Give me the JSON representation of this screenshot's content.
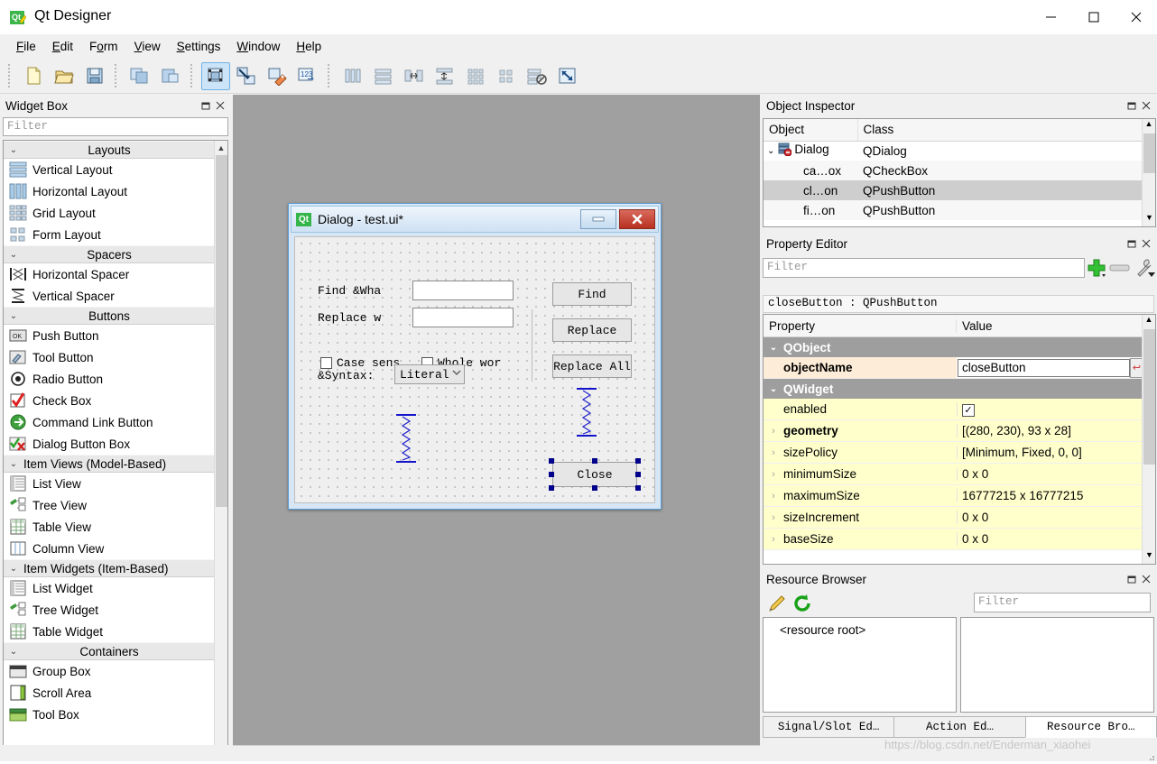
{
  "window": {
    "title": "Qt Designer",
    "app_icon": "qt-designer-icon",
    "minimize": "—",
    "maximize": "□",
    "close": "✕"
  },
  "menubar": [
    {
      "label": "File",
      "accel": "F"
    },
    {
      "label": "Edit",
      "accel": "E"
    },
    {
      "label": "Form",
      "accel": "o"
    },
    {
      "label": "View",
      "accel": "V"
    },
    {
      "label": "Settings",
      "accel": "S"
    },
    {
      "label": "Window",
      "accel": "W"
    },
    {
      "label": "Help",
      "accel": "H"
    }
  ],
  "toolbar": {
    "groups": [
      {
        "items": [
          {
            "name": "new-form-icon"
          },
          {
            "name": "open-form-icon"
          },
          {
            "name": "save-form-icon"
          }
        ]
      },
      {
        "items": [
          {
            "name": "undo-icon"
          },
          {
            "name": "redo-icon"
          }
        ]
      },
      {
        "items": [
          {
            "name": "edit-widgets-icon",
            "active": true
          },
          {
            "name": "edit-signals-slots-icon",
            "active": false
          },
          {
            "name": "edit-buddies-icon",
            "active": false
          },
          {
            "name": "edit-tab-order-icon",
            "active": false
          }
        ]
      },
      {
        "items": [
          {
            "name": "layout-horizontally-icon"
          },
          {
            "name": "layout-vertically-icon"
          },
          {
            "name": "layout-splitter-horizontal-icon"
          },
          {
            "name": "layout-splitter-vertical-icon"
          },
          {
            "name": "layout-grid-icon"
          },
          {
            "name": "layout-form-icon"
          },
          {
            "name": "break-layout-icon"
          },
          {
            "name": "adjust-size-icon"
          }
        ]
      }
    ]
  },
  "widget_box": {
    "title": "Widget Box",
    "float_icon": "float-icon",
    "close_icon": "close-icon",
    "filter_placeholder": "Filter",
    "categories": [
      {
        "name": "Layouts",
        "centered": true,
        "items": [
          {
            "label": "Vertical Layout",
            "icon": "vertical-layout-icon"
          },
          {
            "label": "Horizontal Layout",
            "icon": "horizontal-layout-icon"
          },
          {
            "label": "Grid Layout",
            "icon": "grid-layout-icon"
          },
          {
            "label": "Form Layout",
            "icon": "form-layout-icon"
          }
        ]
      },
      {
        "name": "Spacers",
        "centered": true,
        "items": [
          {
            "label": "Horizontal Spacer",
            "icon": "horizontal-spacer-icon"
          },
          {
            "label": "Vertical Spacer",
            "icon": "vertical-spacer-icon"
          }
        ]
      },
      {
        "name": "Buttons",
        "centered": true,
        "items": [
          {
            "label": "Push Button",
            "icon": "push-button-icon"
          },
          {
            "label": "Tool Button",
            "icon": "tool-button-icon"
          },
          {
            "label": "Radio Button",
            "icon": "radio-button-icon"
          },
          {
            "label": "Check Box",
            "icon": "check-box-icon"
          },
          {
            "label": "Command Link Button",
            "icon": "command-link-button-icon"
          },
          {
            "label": "Dialog Button Box",
            "icon": "dialog-button-box-icon"
          }
        ]
      },
      {
        "name": "Item Views (Model-Based)",
        "centered": false,
        "items": [
          {
            "label": "List View",
            "icon": "list-view-icon"
          },
          {
            "label": "Tree View",
            "icon": "tree-view-icon"
          },
          {
            "label": "Table View",
            "icon": "table-view-icon"
          },
          {
            "label": "Column View",
            "icon": "column-view-icon"
          }
        ]
      },
      {
        "name": "Item Widgets (Item-Based)",
        "centered": false,
        "items": [
          {
            "label": "List Widget",
            "icon": "list-widget-icon"
          },
          {
            "label": "Tree Widget",
            "icon": "tree-widget-icon"
          },
          {
            "label": "Table Widget",
            "icon": "table-widget-icon"
          }
        ]
      },
      {
        "name": "Containers",
        "centered": true,
        "items": [
          {
            "label": "Group Box",
            "icon": "group-box-icon"
          },
          {
            "label": "Scroll Area",
            "icon": "scroll-area-icon"
          },
          {
            "label": "Tool Box",
            "icon": "tool-box-icon"
          }
        ]
      }
    ]
  },
  "form_window": {
    "title": "Dialog - test.ui*",
    "qt_badge": "Qt",
    "minimize": "—",
    "close": "✕",
    "labels": {
      "find_what": "Find &Wha",
      "replace_with": "Replace w",
      "syntax": "&Syntax:"
    },
    "inputs": {
      "find_value": "",
      "replace_value": ""
    },
    "checkboxes": [
      {
        "label": "Case sens",
        "checked": false
      },
      {
        "label": "Whole wor",
        "checked": false
      }
    ],
    "combo": {
      "value": "Literal",
      "arrow": "⌄"
    },
    "buttons": [
      {
        "label": "Find",
        "selected": false
      },
      {
        "label": "Replace",
        "selected": false
      },
      {
        "label": "Replace All",
        "selected": false
      },
      {
        "label": "Close",
        "selected": true
      }
    ],
    "spacers": [
      {
        "name": "vertical-spacer-center"
      },
      {
        "name": "vertical-spacer-right"
      }
    ]
  },
  "object_inspector": {
    "title": "Object Inspector",
    "float_icon": "float-icon",
    "close_icon": "close-icon",
    "columns": [
      "Object",
      "Class"
    ],
    "rows": [
      {
        "object": "Dialog",
        "class": "QDialog",
        "indent": 0,
        "expanded": true,
        "icon": "dialog-icon",
        "selected": false
      },
      {
        "object": "ca…ox",
        "class": "QCheckBox",
        "indent": 1,
        "expanded": false,
        "icon": "",
        "selected": false,
        "alt": true
      },
      {
        "object": "cl…on",
        "class": "QPushButton",
        "indent": 1,
        "expanded": false,
        "icon": "",
        "selected": true
      },
      {
        "object": "fi…on",
        "class": "QPushButton",
        "indent": 1,
        "expanded": false,
        "icon": "",
        "selected": false,
        "alt": true
      }
    ]
  },
  "property_editor": {
    "title": "Property Editor",
    "float_icon": "float-icon",
    "close_icon": "close-icon",
    "filter_placeholder": "Filter",
    "tools": [
      {
        "name": "add-dynamic-property-icon",
        "glyph": "+"
      },
      {
        "name": "remove-dynamic-property-icon",
        "glyph": "—"
      },
      {
        "name": "configure-property-editor-icon",
        "glyph": "wrench"
      }
    ],
    "object_line": "closeButton : QPushButton",
    "columns": [
      "Property",
      "Value"
    ],
    "rows": [
      {
        "kind": "group",
        "name": "QObject",
        "expanded": true
      },
      {
        "kind": "prop",
        "name": "objectName",
        "value": "closeButton",
        "bold": true,
        "peach": true,
        "editing": true,
        "reset": true
      },
      {
        "kind": "group",
        "name": "QWidget",
        "expanded": true
      },
      {
        "kind": "prop",
        "name": "enabled",
        "value": "",
        "checkbox": true,
        "checked": true,
        "yellow": true
      },
      {
        "kind": "prop",
        "name": "geometry",
        "value": "[(280, 230), 93 x 28]",
        "bold": true,
        "expandable": true,
        "yellow": true
      },
      {
        "kind": "prop",
        "name": "sizePolicy",
        "value": "[Minimum, Fixed, 0, 0]",
        "expandable": true,
        "yellow": true
      },
      {
        "kind": "prop",
        "name": "minimumSize",
        "value": "0 x 0",
        "expandable": true,
        "yellow": true
      },
      {
        "kind": "prop",
        "name": "maximumSize",
        "value": "16777215 x 16777215",
        "expandable": true,
        "yellow": true
      },
      {
        "kind": "prop",
        "name": "sizeIncrement",
        "value": "0 x 0",
        "expandable": true,
        "yellow": true
      },
      {
        "kind": "prop",
        "name": "baseSize",
        "value": "0 x 0",
        "expandable": true,
        "yellow": true
      }
    ]
  },
  "resource_browser": {
    "title": "Resource Browser",
    "float_icon": "float-icon",
    "close_icon": "close-icon",
    "tools": [
      {
        "name": "edit-resources-icon",
        "glyph": "pencil"
      },
      {
        "name": "reload-icon",
        "glyph": "reload"
      }
    ],
    "filter_placeholder": "Filter",
    "tree_root": "<resource root>",
    "tabs": [
      {
        "label": "Signal/Slot Ed…",
        "selected": false
      },
      {
        "label": "Action Ed…",
        "selected": false
      },
      {
        "label": "Resource Bro…",
        "selected": true
      }
    ]
  },
  "watermark": "https://blog.csdn.net/Enderman_xiaohei",
  "colors": {
    "workspace_bg": "#a0a0a0",
    "chrome_bg": "#f0f0f0",
    "accent_blue": "#cce4f7",
    "group_header": "#9e9e9e",
    "prop_yellow": "#ffffcc",
    "prop_peach": "#fdecd7",
    "selection_handle": "#00008b",
    "qt_green": "#36b54a"
  }
}
